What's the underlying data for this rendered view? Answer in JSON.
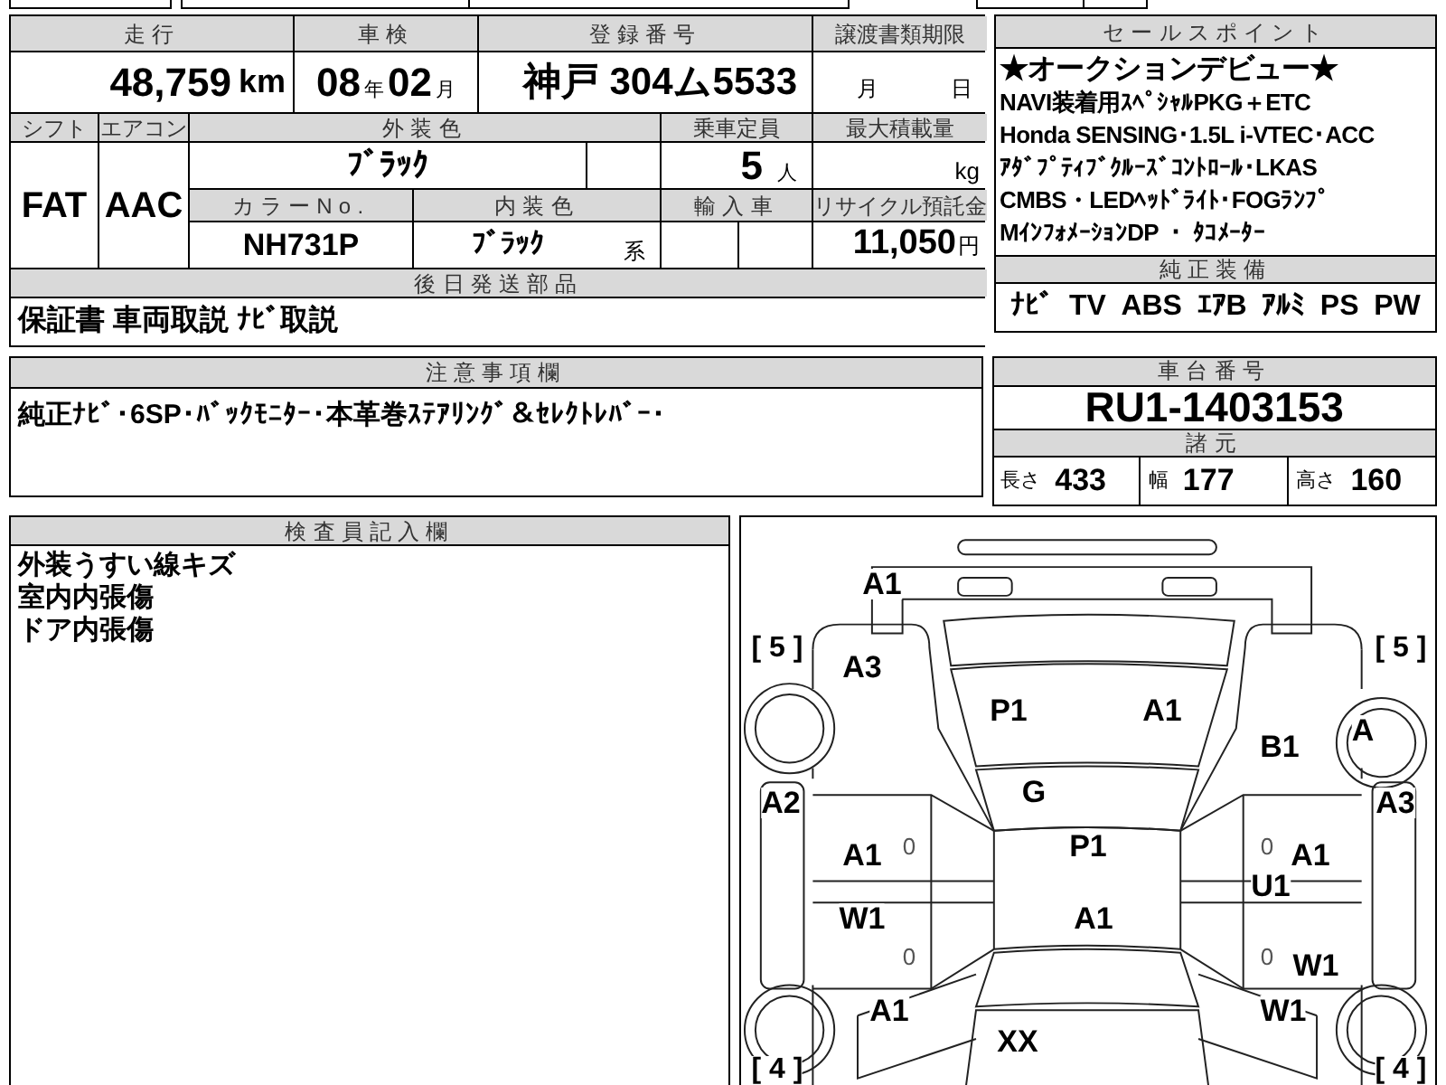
{
  "mileage": {
    "label": "走行",
    "value": "48,759",
    "unit": "km"
  },
  "inspection": {
    "label": "車検",
    "year": "08",
    "year_unit": "年",
    "month": "02",
    "month_unit": "月"
  },
  "registration": {
    "label": "登録番号",
    "value": "神戸 304ム5533"
  },
  "transfer_deadline": {
    "label": "譲渡書類期限",
    "month_unit": "月",
    "day_unit": "日"
  },
  "shift": {
    "label": "シフト",
    "value": "FAT"
  },
  "aircon": {
    "label": "エアコン",
    "value": "AAC"
  },
  "exterior_color": {
    "label": "外装色",
    "value": "ﾌﾞﾗｯｸ"
  },
  "capacity": {
    "label": "乗車定員",
    "value": "5",
    "unit": "人"
  },
  "max_load": {
    "label": "最大積載量",
    "unit": "kg"
  },
  "color_no": {
    "label": "カラーNo.",
    "value": "NH731P"
  },
  "interior_color": {
    "label": "内装色",
    "value": "ﾌﾞﾗｯｸ",
    "suffix": "系"
  },
  "imported": {
    "label": "輸入車"
  },
  "recycling_fee": {
    "label": "リサイクル預託金",
    "value": "11,050",
    "unit": "円"
  },
  "deferred_parts": {
    "label": "後日発送部品",
    "value": "保証書 車両取説 ﾅﾋﾞ取説"
  },
  "sales_points": {
    "label": "セールスポイント",
    "lines": [
      "★オークションデビュー★",
      "NAVI装着用ｽﾍﾟｼｬﾙPKG＋ETC",
      "Honda SENSING･1.5L i-VTEC･ACC",
      "ｱﾀﾞﾌﾟﾃｨﾌﾞｸﾙｰｽﾞｺﾝﾄﾛｰﾙ･LKAS",
      "CMBS・LEDﾍｯﾄﾞﾗｲﾄ･FOGﾗﾝﾌﾟ",
      "MｲﾝﾌｫﾒｰｼｮﾝDP ・ ﾀｺﾒｰﾀｰ"
    ]
  },
  "factory_equipment": {
    "label": "純正装備",
    "items": [
      "ﾅﾋﾞ",
      "TV",
      "ABS",
      "ｴｱB",
      "ｱﾙﾐ",
      "PS",
      "PW"
    ]
  },
  "notes": {
    "label": "注意事項欄",
    "text": "純正ﾅﾋﾞ･6SP･ﾊﾞｯｸﾓﾆﾀｰ･本革巻ｽﾃｱﾘﾝｸﾞ＆ｾﾚｸﾄﾚﾊﾞｰ･"
  },
  "chassis_number": {
    "label": "車台番号",
    "value": "RU1-1403153"
  },
  "specs": {
    "label": "諸元",
    "items": [
      {
        "label": "長さ",
        "value": "433"
      },
      {
        "label": "幅",
        "value": "177"
      },
      {
        "label": "高さ",
        "value": "160"
      }
    ]
  },
  "inspector_notes": {
    "label": "検査員記入欄",
    "lines": [
      "外装うすい線キズ",
      "室内内張傷",
      "ドア内張傷"
    ]
  },
  "damage_map": {
    "marks": [
      {
        "kind": "code",
        "text": "A1"
      },
      {
        "kind": "tread",
        "text": "[ 5 ]"
      },
      {
        "kind": "tread",
        "text": "[ 5 ]"
      },
      {
        "kind": "code",
        "text": "A3"
      },
      {
        "kind": "code",
        "text": "P1"
      },
      {
        "kind": "code",
        "text": "A1"
      },
      {
        "kind": "code",
        "text": "A"
      },
      {
        "kind": "code",
        "text": "B1"
      },
      {
        "kind": "code",
        "text": "A2"
      },
      {
        "kind": "code",
        "text": "G"
      },
      {
        "kind": "code",
        "text": "A3"
      },
      {
        "kind": "code",
        "text": "A1"
      },
      {
        "kind": "zero",
        "text": "0"
      },
      {
        "kind": "code",
        "text": "P1"
      },
      {
        "kind": "zero",
        "text": "0"
      },
      {
        "kind": "code",
        "text": "A1"
      },
      {
        "kind": "code",
        "text": "U1"
      },
      {
        "kind": "code",
        "text": "W1"
      },
      {
        "kind": "code",
        "text": "A1"
      },
      {
        "kind": "zero",
        "text": "0"
      },
      {
        "kind": "zero",
        "text": "0"
      },
      {
        "kind": "code",
        "text": "W1"
      },
      {
        "kind": "code",
        "text": "A1"
      },
      {
        "kind": "code",
        "text": "W1"
      },
      {
        "kind": "code",
        "text": "XX"
      },
      {
        "kind": "tread",
        "text": "[ 4 ]"
      },
      {
        "kind": "tread",
        "text": "[ 4 ]"
      }
    ]
  }
}
